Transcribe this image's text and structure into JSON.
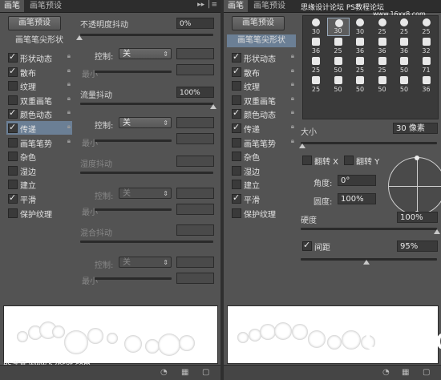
{
  "left_panel": {
    "tabs": [
      "画笔",
      "画笔预设"
    ],
    "menu_icon": "panel-menu-icon",
    "preset_button": "画笔预设",
    "tip_shape_label": "画笔笔尖形状",
    "options": [
      {
        "label": "形状动态",
        "checked": true
      },
      {
        "label": "散布",
        "checked": true
      },
      {
        "label": "纹理",
        "checked": false
      },
      {
        "label": "双重画笔",
        "checked": false
      },
      {
        "label": "颜色动态",
        "checked": true
      },
      {
        "label": "传递",
        "checked": true,
        "selected": true
      },
      {
        "label": "画笔笔势",
        "checked": false
      },
      {
        "label": "杂色",
        "checked": false
      },
      {
        "label": "湿边",
        "checked": false
      },
      {
        "label": "建立",
        "checked": false
      },
      {
        "label": "平滑",
        "checked": true
      },
      {
        "label": "保护纹理",
        "checked": false
      }
    ],
    "opacity_jitter_label": "不透明度抖动",
    "opacity_jitter_value": "0%",
    "control_label": "控制:",
    "control_value": "关",
    "min_label": "最小",
    "flow_jitter_label": "流量抖动",
    "flow_jitter_value": "100%",
    "control2_label": "控制:",
    "control2_value": "关",
    "min2_label": "最小",
    "wetness_jitter_label": "湿度抖动",
    "control3_label": "控制:",
    "control3_value": "关",
    "min3_label": "最小",
    "mix_jitter_label": "混合抖动",
    "control4_label": "控制:",
    "control4_value": "关",
    "min4_label": "最小",
    "watermark": "PS学堂 www.52psxt.com"
  },
  "right_panel": {
    "watermark_top": "思缘设计论坛  PS教程论坛",
    "watermark_top2": "www.16xx8.com",
    "tabs": [
      "画笔",
      "画笔预设"
    ],
    "preset_button": "画笔预设",
    "tip_shape_label": "画笔笔尖形状",
    "options": [
      {
        "label": "形状动态",
        "checked": true
      },
      {
        "label": "散布",
        "checked": true
      },
      {
        "label": "纹理",
        "checked": false
      },
      {
        "label": "双重画笔",
        "checked": false
      },
      {
        "label": "颜色动态",
        "checked": true
      },
      {
        "label": "传递",
        "checked": true
      },
      {
        "label": "画笔笔势",
        "checked": false
      },
      {
        "label": "杂色",
        "checked": false
      },
      {
        "label": "湿边",
        "checked": false
      },
      {
        "label": "建立",
        "checked": false
      },
      {
        "label": "平滑",
        "checked": true
      },
      {
        "label": "保护纹理",
        "checked": false
      }
    ],
    "brush_tips": [
      "30",
      "30",
      "30",
      "25",
      "25",
      "25",
      "36",
      "25",
      "36",
      "36",
      "36",
      "32",
      "25",
      "50",
      "25",
      "25",
      "50",
      "71",
      "25",
      "50",
      "50",
      "50",
      "50",
      "36"
    ],
    "size_label": "大小",
    "size_value": "30 像素",
    "flip_x_label": "翻转 X",
    "flip_y_label": "翻转 Y",
    "angle_label": "角度:",
    "angle_value": "0°",
    "roundness_label": "圆度:",
    "roundness_value": "100%",
    "hardness_label": "硬度",
    "hardness_value": "100%",
    "spacing_label": "间距",
    "spacing_value": "95%",
    "spacing_checked": true,
    "watermark_bottom": "UiBQ.CoM"
  }
}
